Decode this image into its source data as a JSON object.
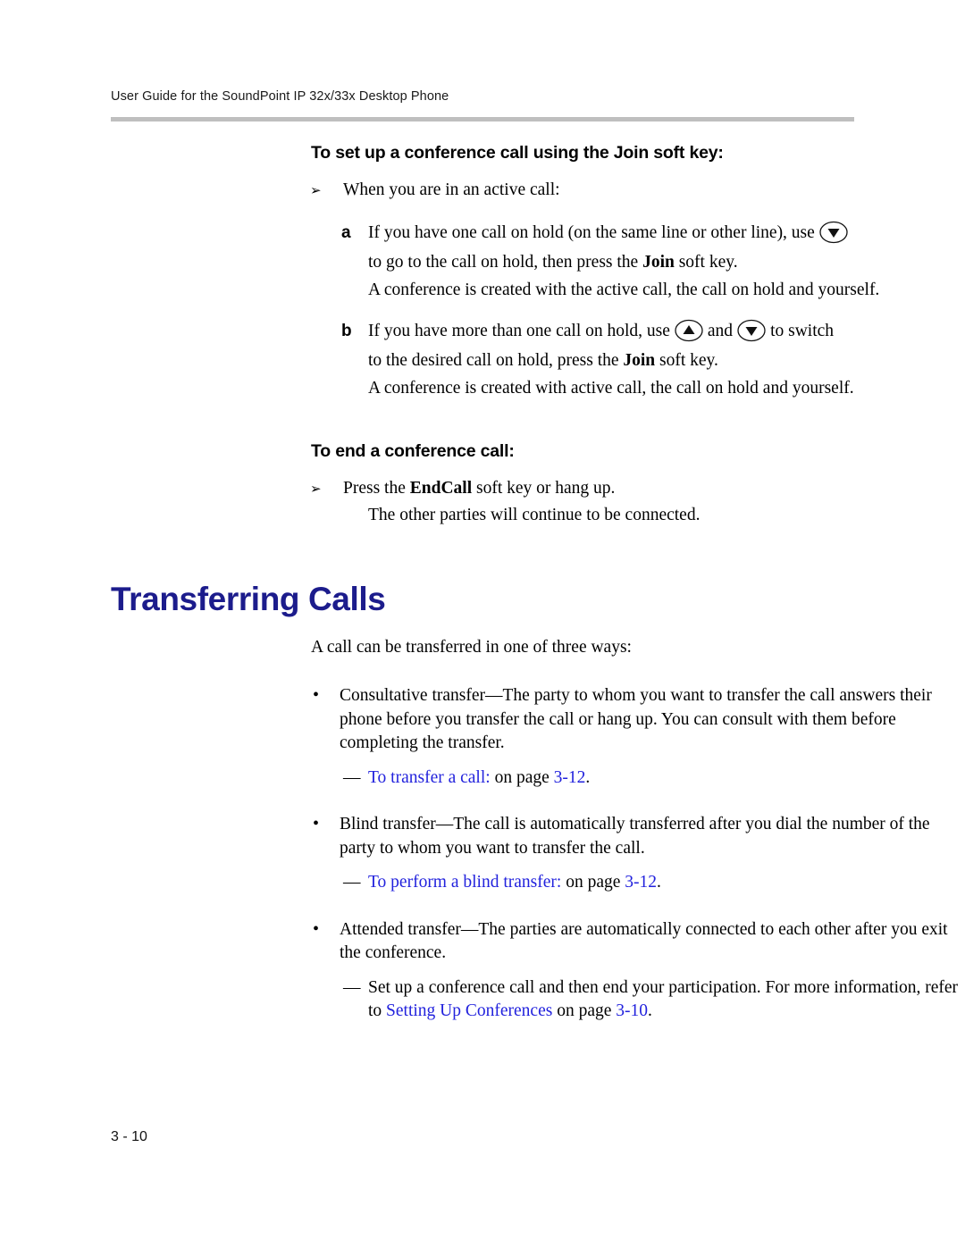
{
  "header": {
    "running_title": "User Guide for the SoundPoint IP 32x/33x Desktop Phone"
  },
  "procedures": [
    {
      "heading": "To set up a conference call using the Join soft key:",
      "intro": "When you are in an active call:",
      "steps": [
        {
          "letter": "a",
          "line1_before_icon": "If you have one call on hold (on the same line or other line), use",
          "icon": "arrow-down-key-icon",
          "line2": "to go to the call on hold, then press the ",
          "line2_bold": "Join",
          "line2_after": " soft key.",
          "result": "A conference is created with the active call, the call on hold and yourself."
        },
        {
          "letter": "b",
          "line1_before_icon": "If you have more than one call on hold, use",
          "icon_up": "arrow-up-key-icon",
          "conjunction": "and",
          "icon_down": "arrow-down-key-icon",
          "line1_after_icons": "to switch",
          "line2": "to the desired call on hold, press the ",
          "line2_bold": "Join",
          "line2_after": " soft key.",
          "result": "A conference is created with active call, the call on hold and yourself."
        }
      ]
    },
    {
      "heading": "To end a conference call:",
      "step_before_bold": "Press the ",
      "step_bold": "EndCall",
      "step_after_bold": " soft key or hang up.",
      "result": "The other parties will continue to be connected."
    }
  ],
  "section": {
    "title": "Transferring Calls",
    "title_color": "#1c1c8c",
    "intro": "A call can be transferred in one of three ways:",
    "bullets": [
      {
        "text": "Consultative transfer—The party to whom you want to transfer the call answers their phone before you transfer the call or hang up. You can consult with them before completing the transfer.",
        "subitem": {
          "link_text": "To transfer a call:",
          "middle_text": " on page ",
          "page_ref": "3-12",
          "end_text": "."
        }
      },
      {
        "text": "Blind transfer—The call is automatically transferred after you dial the number of the party to whom you want to transfer the call.",
        "subitem": {
          "link_text": "To perform a blind transfer:",
          "middle_text": " on page ",
          "page_ref": "3-12",
          "end_text": "."
        }
      },
      {
        "text": "Attended transfer—The parties are automatically connected to each other after you exit the conference.",
        "subitem": {
          "lead_text": "Set up a conference call and then end your participation. For more information, refer to ",
          "link_text": "Setting Up Conferences",
          "middle_text": " on page ",
          "page_ref": "3-10",
          "end_text": "."
        }
      }
    ]
  },
  "footer": {
    "page_number": "3 - 10"
  },
  "colors": {
    "link_blue": "#2222dd",
    "title_navy": "#1c1c8c",
    "rule_gray": "#bfbfbf"
  },
  "markers": {
    "arrow_bullet": "➢",
    "dot_bullet": "•",
    "dash_bullet": "—"
  }
}
